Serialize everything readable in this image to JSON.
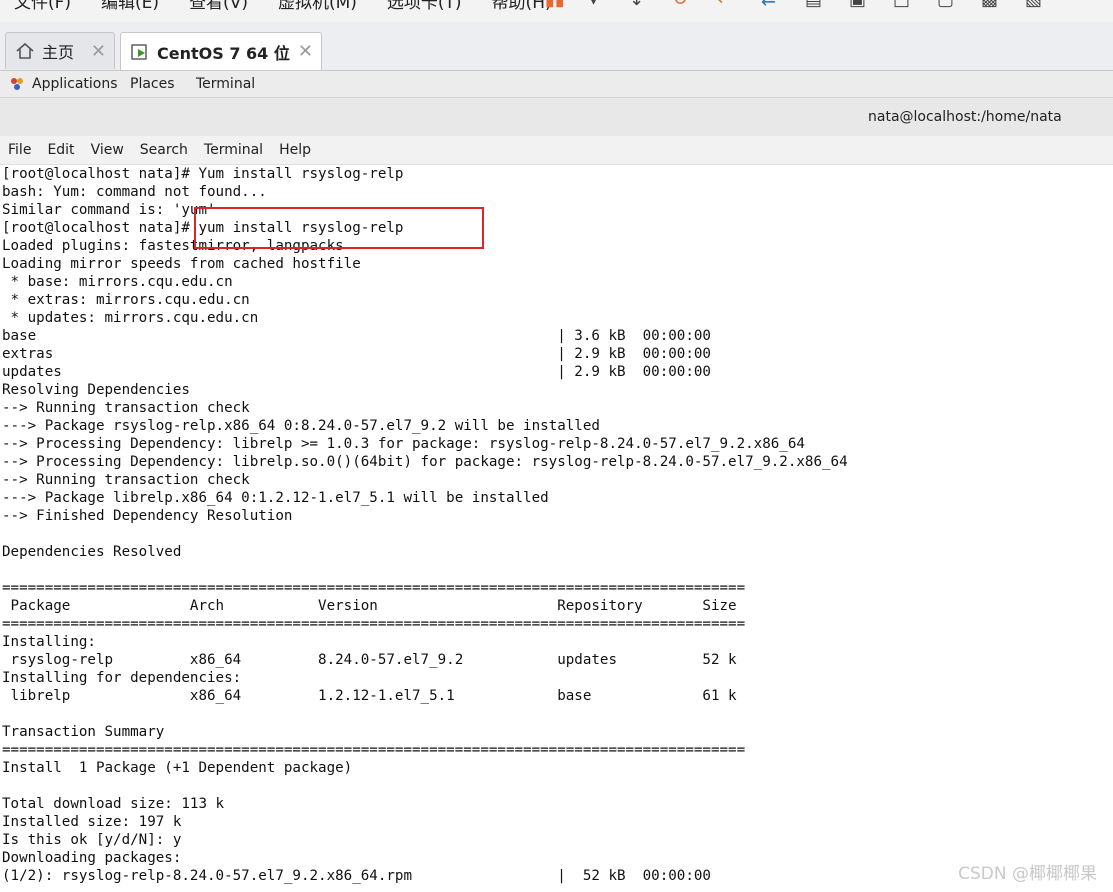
{
  "vm_menu": {
    "items": [
      "文件(F)",
      "编辑(E)",
      "查看(V)",
      "虚拟机(M)",
      "选项卡(T)",
      "帮助(H)"
    ]
  },
  "tabs": [
    {
      "label": "主页",
      "icon": "home-icon"
    },
    {
      "label": "CentOS 7 64 位",
      "icon": "vm-icon"
    }
  ],
  "gnome_bar": {
    "applications": "Applications",
    "places": "Places",
    "terminal": "Terminal"
  },
  "window": {
    "title": "nata@localhost:/home/nata"
  },
  "terminal_menu": [
    "File",
    "Edit",
    "View",
    "Search",
    "Terminal",
    "Help"
  ],
  "terminal_lines": [
    "[root@localhost nata]# Yum install rsyslog-relp",
    "bash: Yum: command not found...",
    "Similar command is: 'yum'",
    "[root@localhost nata]# yum install rsyslog-relp",
    "Loaded plugins: fastestmirror, langpacks",
    "Loading mirror speeds from cached hostfile",
    " * base: mirrors.cqu.edu.cn",
    " * extras: mirrors.cqu.edu.cn",
    " * updates: mirrors.cqu.edu.cn",
    "base                                                             | 3.6 kB  00:00:00",
    "extras                                                           | 2.9 kB  00:00:00",
    "updates                                                          | 2.9 kB  00:00:00",
    "Resolving Dependencies",
    "--> Running transaction check",
    "---> Package rsyslog-relp.x86_64 0:8.24.0-57.el7_9.2 will be installed",
    "--> Processing Dependency: librelp >= 1.0.3 for package: rsyslog-relp-8.24.0-57.el7_9.2.x86_64",
    "--> Processing Dependency: librelp.so.0()(64bit) for package: rsyslog-relp-8.24.0-57.el7_9.2.x86_64",
    "--> Running transaction check",
    "---> Package librelp.x86_64 0:1.2.12-1.el7_5.1 will be installed",
    "--> Finished Dependency Resolution",
    "",
    "Dependencies Resolved",
    "",
    "=======================================================================================",
    " Package              Arch           Version                     Repository       Size",
    "=======================================================================================",
    "Installing:",
    " rsyslog-relp         x86_64         8.24.0-57.el7_9.2           updates          52 k",
    "Installing for dependencies:",
    " librelp              x86_64         1.2.12-1.el7_5.1            base             61 k",
    "",
    "Transaction Summary",
    "=======================================================================================",
    "Install  1 Package (+1 Dependent package)",
    "",
    "Total download size: 113 k",
    "Installed size: 197 k",
    "Is this ok [y/d/N]: y",
    "Downloading packages:",
    "(1/2): rsyslog-relp-8.24.0-57.el7_9.2.x86_64.rpm                 |  52 kB  00:00:00"
  ],
  "watermark": "CSDN @椰椰椰果",
  "colors": {
    "highlight": "#d9262b",
    "vm_icon": "#3a9a28"
  }
}
